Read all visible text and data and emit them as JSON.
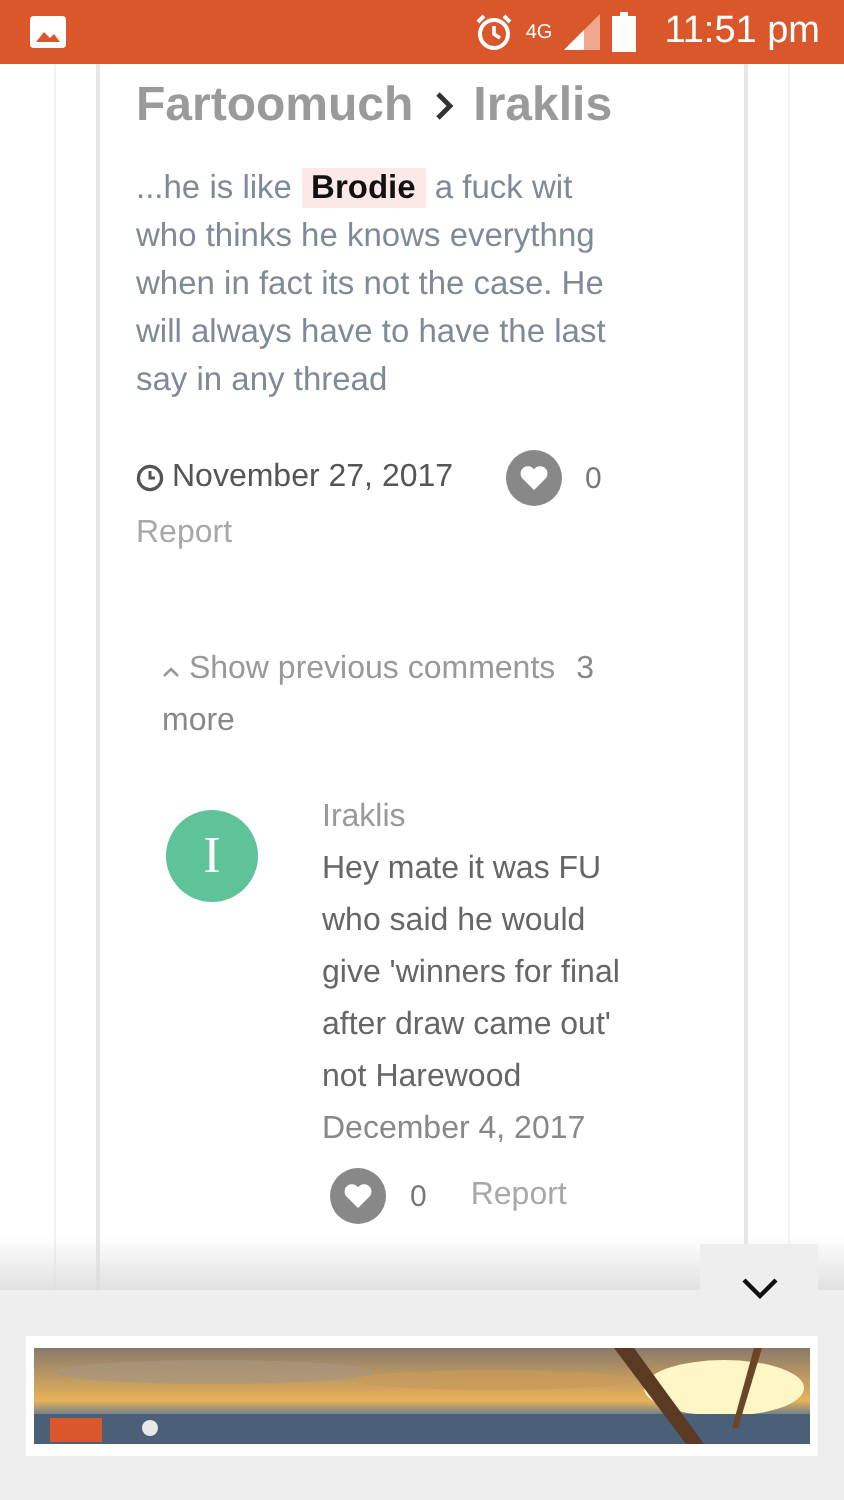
{
  "status_bar": {
    "network": "4G",
    "time": "11:51 pm"
  },
  "comment": {
    "author": "Fartoomuch",
    "recipient": "Iraklis",
    "text": "...he is like **Brodie** a fuck wit who thinks he knows everythng when in fact its not the case. He will always have to have the last say in any thread",
    "date": "November 27, 2017",
    "likes": "0",
    "report": "Report"
  },
  "previous_comments": {
    "label": "Show previous comments",
    "count": "3 more"
  },
  "reply": {
    "avatar_letter": "I",
    "author": "Iraklis",
    "text": "Hey mate it was FU who said he would give 'winners for final after draw came out' not Harewood",
    "date": "December 4, 2017",
    "likes": "0",
    "report": "Report"
  }
}
